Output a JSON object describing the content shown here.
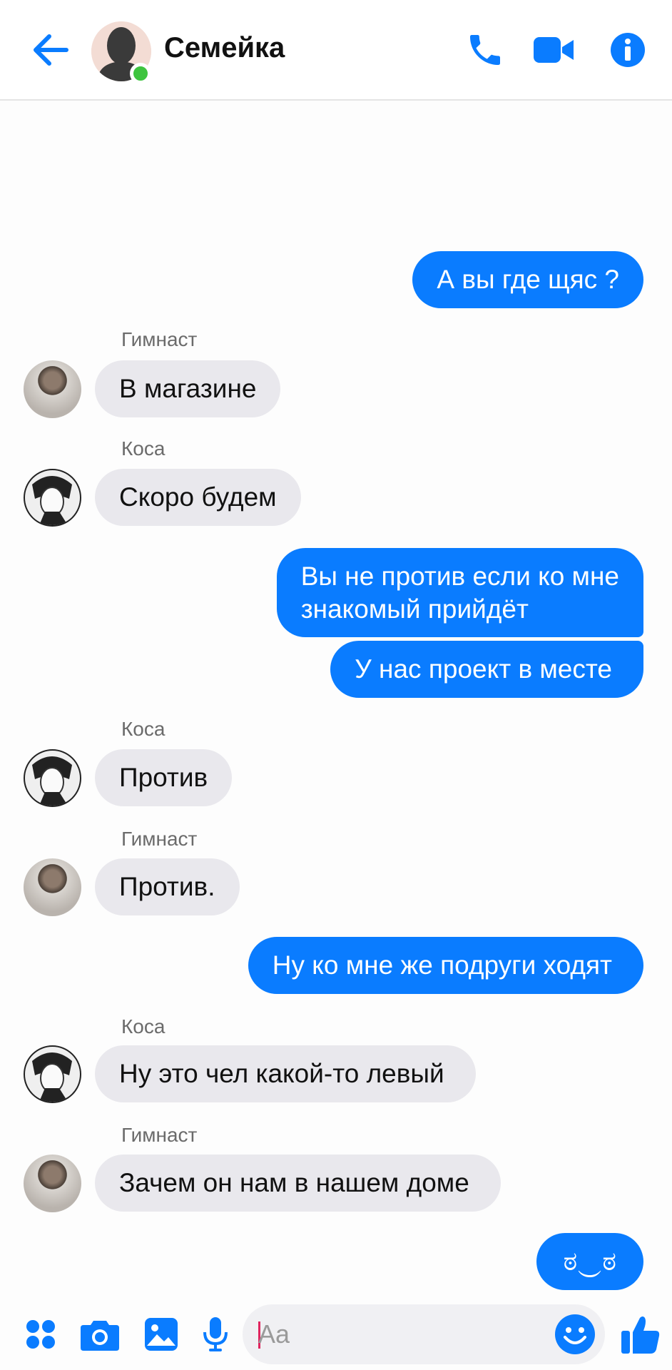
{
  "header": {
    "title": "Семейка",
    "back_icon": "back-arrow-icon",
    "call_icon": "phone-icon",
    "video_icon": "video-camera-icon",
    "info_icon": "info-icon",
    "online": true,
    "accent": "#0a7cff"
  },
  "messages": [
    {
      "direction": "out",
      "text": "А вы где щяс ?"
    },
    {
      "direction": "in",
      "sender": "Гимнаст",
      "text": "В магазине"
    },
    {
      "direction": "in",
      "sender": "Коса",
      "text": "Скоро будем"
    },
    {
      "direction": "out",
      "lines": [
        "Вы не против если ко мне",
        "знакомый прийдёт"
      ]
    },
    {
      "direction": "out",
      "text": "У нас проект в месте"
    },
    {
      "direction": "in",
      "sender": "Коса",
      "text": "Против"
    },
    {
      "direction": "in",
      "sender": "Гимнаст",
      "text": "Против."
    },
    {
      "direction": "out",
      "text": "Ну ко мне же подруги ходят"
    },
    {
      "direction": "in",
      "sender": "Коса",
      "text": "Ну это чел какой-то левый"
    },
    {
      "direction": "in",
      "sender": "Гимнаст",
      "text": "Зачем он нам в нашем доме"
    },
    {
      "direction": "out",
      "text": "ಠ‿ಠ"
    }
  ],
  "composer": {
    "placeholder": "Aa",
    "icons": [
      "apps-icon",
      "camera-icon",
      "gallery-icon",
      "microphone-icon",
      "emoji-icon",
      "thumbs-up-icon"
    ]
  }
}
